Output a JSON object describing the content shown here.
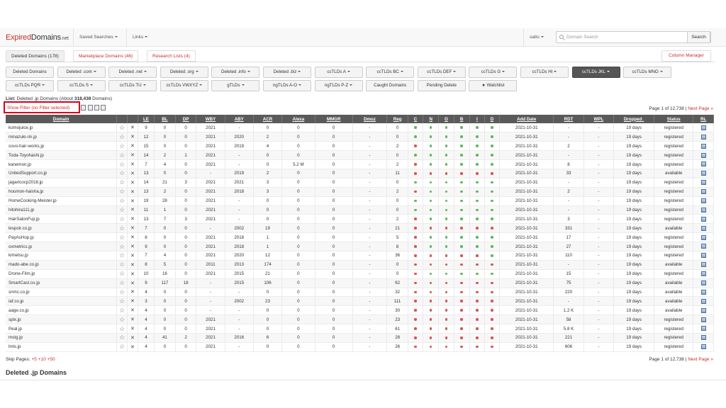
{
  "brand": {
    "part1": "Expired",
    "part2": "Domains",
    "part3": ".net"
  },
  "nav": {
    "saved_searches": "Saved Searches",
    "links": "Links",
    "user": "saito"
  },
  "search": {
    "placeholder": "Domain Search",
    "value": "",
    "button": "Search"
  },
  "tabs": [
    {
      "label": "Deleted Domains (178)",
      "active": true
    },
    {
      "label": "Marketplace Domains (46)",
      "active": false
    },
    {
      "label": "Research Lists (4)",
      "active": false
    }
  ],
  "column_manager": "Column Manager",
  "filters_row1": [
    {
      "label": "Deleted Domains",
      "caret": false,
      "active": false
    },
    {
      "label": "Deleted .com",
      "caret": true,
      "active": false
    },
    {
      "label": "Deleted .net",
      "caret": true,
      "active": false
    },
    {
      "label": "Deleted .org",
      "caret": true,
      "active": false
    },
    {
      "label": "Deleted .info",
      "caret": true,
      "active": false
    },
    {
      "label": "Deleted .biz",
      "caret": true,
      "active": false
    },
    {
      "label": "ccTLDs A",
      "caret": true,
      "active": false
    },
    {
      "label": "ccTLDs BC",
      "caret": true,
      "active": false
    },
    {
      "label": "ccTLDs DEF",
      "caret": true,
      "active": false
    },
    {
      "label": "ccTLDs G",
      "caret": true,
      "active": false
    },
    {
      "label": "ccTLDs HI",
      "caret": true,
      "active": false
    },
    {
      "label": "ccTLDs JKL",
      "caret": true,
      "active": true
    },
    {
      "label": "ccTLDs MNO",
      "caret": true,
      "active": false
    }
  ],
  "filters_row2": [
    {
      "label": "ccTLDs PQR",
      "caret": true
    },
    {
      "label": "ccTLDs S",
      "caret": true
    },
    {
      "label": "ccTLDs TU",
      "caret": true
    },
    {
      "label": "ccTLDs VWXYZ",
      "caret": true
    },
    {
      "label": "gTLDs",
      "caret": true
    },
    {
      "label": "ngTLDs A-O",
      "caret": true
    },
    {
      "label": "ngTLDs P-Z",
      "caret": true
    },
    {
      "label": "Caught Domains",
      "caret": false
    },
    {
      "label": "Pending Delete",
      "caret": false
    },
    {
      "label": "★ Watchlist",
      "caret": false
    }
  ],
  "list_info": {
    "prefix": "List:",
    "name": "Deleted .jp Domains (About",
    "count": "318,438",
    "suffix": "Domains)"
  },
  "show_filter": "Show Filter (no Filter selected)",
  "pager": {
    "text": "Page 1 of 12,738 |",
    "next": "Next Page »"
  },
  "columns": [
    "Domain",
    "",
    "",
    "LE",
    "BL",
    "DP",
    "WBY",
    "ABY",
    "ACR",
    "Alexa",
    "MMGR",
    "Dmoz",
    "Reg",
    "C",
    "N",
    "O",
    "B",
    "I",
    "D",
    "Add Date",
    "RDT",
    "WPL",
    "Dropped",
    "Status",
    "RL"
  ],
  "dropped_arrow": "↓",
  "rows": [
    {
      "domain": "komojuice.jp",
      "le": "9",
      "bl": "0",
      "dp": "0",
      "wby": "2021",
      "aby": "-",
      "acr": "0",
      "alexa": "0",
      "mmgr": "0",
      "dmoz": "-",
      "reg": "0",
      "dots": "gggggg",
      "date": "2021-10-31",
      "rdt": "-",
      "wpl": "-",
      "dropped": "19 days",
      "status": "registered"
    },
    {
      "domain": "minazuki-rin.jp",
      "le": "12",
      "bl": "0",
      "dp": "0",
      "wby": "2021",
      "aby": "2020",
      "acr": "2",
      "alexa": "0",
      "mmgr": "0",
      "dmoz": "-",
      "reg": "0",
      "dots": "gggggg",
      "date": "2021-10-31",
      "rdt": "-",
      "wpl": "-",
      "dropped": "19 days",
      "status": "registered"
    },
    {
      "domain": "covo-hair-works.jp",
      "le": "15",
      "bl": "0",
      "dp": "0",
      "wby": "2021",
      "aby": "2019",
      "acr": "4",
      "alexa": "0",
      "mmgr": "0",
      "dmoz": "-",
      "reg": "2",
      "dots": "rggggg",
      "date": "2021-10-31",
      "rdt": "2",
      "wpl": "-",
      "dropped": "19 days",
      "status": "registered"
    },
    {
      "domain": "Toda-Toyohashi.jp",
      "le": "14",
      "bl": "2",
      "dp": "1",
      "wby": "2021",
      "aby": "-",
      "acr": "0",
      "alexa": "0",
      "mmgr": "0",
      "dmoz": "-",
      "reg": "0",
      "dots": "gggggg",
      "date": "2021-10-31",
      "rdt": "-",
      "wpl": "-",
      "dropped": "19 days",
      "status": "registered"
    },
    {
      "domain": "kanemon.jp",
      "le": "7",
      "bl": "4",
      "dp": "0",
      "wby": "2021",
      "aby": "-",
      "acr": "0",
      "alexa": "5.2 M",
      "mmgr": "0",
      "dmoz": "-",
      "reg": "2",
      "dots": "rggggg",
      "date": "2021-10-31",
      "rdt": "8",
      "wpl": "-",
      "dropped": "19 days",
      "status": "registered"
    },
    {
      "domain": "UnitedSupport.co.jp",
      "le": "13",
      "bl": "0",
      "dp": "0",
      "wby": "-",
      "aby": "2019",
      "acr": "2",
      "alexa": "0",
      "mmgr": "0",
      "dmoz": "-",
      "reg": "11",
      "dots": "rrrrrr",
      "date": "2021-10-31",
      "rdt": "33",
      "wpl": "-",
      "dropped": "19 days",
      "status": "available"
    },
    {
      "domain": "jagaricocp2018.jp",
      "le": "14",
      "bl": "21",
      "dp": "3",
      "wby": "2021",
      "aby": "2021",
      "acr": "3",
      "alexa": "0",
      "mmgr": "0",
      "dmoz": "-",
      "reg": "0",
      "dots": "gggggg",
      "date": "2021-10-31",
      "rdt": "-",
      "wpl": "-",
      "dropped": "19 days",
      "status": "registered"
    },
    {
      "domain": "houmon-haisha.jp",
      "le": "13",
      "bl": "2",
      "dp": "0",
      "wby": "2021",
      "aby": "2018",
      "acr": "3",
      "alexa": "0",
      "mmgr": "0",
      "dmoz": "-",
      "reg": "2",
      "dots": "rggggg",
      "date": "2021-10-31",
      "rdt": "2",
      "wpl": "-",
      "dropped": "19 days",
      "status": "registered"
    },
    {
      "domain": "HomeCooking-Meister.jp",
      "le": "19",
      "bl": "28",
      "dp": "0",
      "wby": "2021",
      "aby": "-",
      "acr": "0",
      "alexa": "0",
      "mmgr": "0",
      "dmoz": "-",
      "reg": "0",
      "dots": "gggggg",
      "date": "2021-10-31",
      "rdt": "-",
      "wpl": "-",
      "dropped": "19 days",
      "status": "registered"
    },
    {
      "domain": "hitohira111.jp",
      "le": "11",
      "bl": "1",
      "dp": "0",
      "wby": "2021",
      "aby": "-",
      "acr": "0",
      "alexa": "0",
      "mmgr": "0",
      "dmoz": "-",
      "reg": "0",
      "dots": "gggggg",
      "date": "2021-10-31",
      "rdt": "-",
      "wpl": "-",
      "dropped": "19 days",
      "status": "registered"
    },
    {
      "domain": "HairSalonFuji.jp",
      "le": "13",
      "bl": "7",
      "dp": "3",
      "wby": "2021",
      "aby": "-",
      "acr": "0",
      "alexa": "0",
      "mmgr": "0",
      "dmoz": "-",
      "reg": "2",
      "dots": "rggggg",
      "date": "2021-10-31",
      "rdt": "3",
      "wpl": "-",
      "dropped": "19 days",
      "status": "registered"
    },
    {
      "domain": "lespoir.co.jp",
      "le": "7",
      "bl": "0",
      "dp": "0",
      "wby": "-",
      "aby": "2002",
      "acr": "19",
      "alexa": "0",
      "mmgr": "0",
      "dmoz": "-",
      "reg": "21",
      "dots": "rrrrrr",
      "date": "2021-10-31",
      "rdt": "331",
      "wpl": "-",
      "dropped": "19 days",
      "status": "available"
    },
    {
      "domain": "PayAsHop.jp",
      "le": "8",
      "bl": "0",
      "dp": "0",
      "wby": "2021",
      "aby": "2018",
      "acr": "1",
      "alexa": "0",
      "mmgr": "0",
      "dmoz": "-",
      "reg": "5",
      "dots": "rggggg",
      "date": "2021-10-31",
      "rdt": "17",
      "wpl": "-",
      "dropped": "19 days",
      "status": "registered"
    },
    {
      "domain": "oxmetrics.jp",
      "le": "9",
      "bl": "0",
      "dp": "0",
      "wby": "2021",
      "aby": "2018",
      "acr": "1",
      "alexa": "0",
      "mmgr": "0",
      "dmoz": "-",
      "reg": "8",
      "dots": "rggggg",
      "date": "2021-10-31",
      "rdt": "27",
      "wpl": "-",
      "dropped": "19 days",
      "status": "registered"
    },
    {
      "domain": "kimetsu.jp",
      "le": "7",
      "bl": "4",
      "dp": "0",
      "wby": "2021",
      "aby": "2020",
      "acr": "12",
      "alexa": "0",
      "mmgr": "0",
      "dmoz": "-",
      "reg": "36",
      "dots": "rrrrrg",
      "date": "2021-10-31",
      "rdt": "110",
      "wpl": "-",
      "dropped": "19 days",
      "status": "registered"
    },
    {
      "domain": "mado-abe.co.jp",
      "le": "8",
      "bl": "5",
      "dp": "0",
      "wby": "2011",
      "aby": "2013",
      "acr": "174",
      "alexa": "0",
      "mmgr": "0",
      "dmoz": "-",
      "reg": "0",
      "dots": "rrrrrr",
      "date": "2021-10-31",
      "rdt": "-",
      "wpl": "-",
      "dropped": "19 days",
      "status": "available"
    },
    {
      "domain": "Drone-Film.jp",
      "le": "10",
      "bl": "16",
      "dp": "0",
      "wby": "2021",
      "aby": "2015",
      "acr": "21",
      "alexa": "0",
      "mmgr": "0",
      "dmoz": "-",
      "reg": "0",
      "dots": "rggggg",
      "date": "2021-10-31",
      "rdt": "15",
      "wpl": "-",
      "dropped": "19 days",
      "status": "registered"
    },
    {
      "domain": "SmartCast.co.jp",
      "le": "9",
      "bl": "117",
      "dp": "18",
      "wby": "-",
      "aby": "2015",
      "acr": "106",
      "alexa": "0",
      "mmgr": "0",
      "dmoz": "-",
      "reg": "62",
      "dots": "rrrrrr",
      "date": "2021-10-31",
      "rdt": "75",
      "wpl": "-",
      "dropped": "19 days",
      "status": "available"
    },
    {
      "domain": "snmc.co.jp",
      "le": "4",
      "bl": "0",
      "dp": "0",
      "wby": "-",
      "aby": "-",
      "acr": "0",
      "alexa": "0",
      "mmgr": "0",
      "dmoz": "-",
      "reg": "32",
      "dots": "rrrrrr",
      "date": "2021-10-31",
      "rdt": "220",
      "wpl": "-",
      "dropped": "19 days",
      "status": "available"
    },
    {
      "domain": "iaf.co.jp",
      "le": "3",
      "bl": "0",
      "dp": "0",
      "wby": "-",
      "aby": "2002",
      "acr": "23",
      "alexa": "0",
      "mmgr": "0",
      "dmoz": "-",
      "reg": "111",
      "dots": "rrrrrr",
      "date": "2021-10-31",
      "rdt": "-",
      "wpl": "-",
      "dropped": "19 days",
      "status": "available"
    },
    {
      "domain": "aage.co.jp",
      "le": "4",
      "bl": "0",
      "dp": "0",
      "wby": "-",
      "aby": "-",
      "acr": "0",
      "alexa": "0",
      "mmgr": "0",
      "dmoz": "-",
      "reg": "30",
      "dots": "rrrrrr",
      "date": "2021-10-31",
      "rdt": "1.2 K",
      "wpl": "-",
      "dropped": "19 days",
      "status": "available"
    },
    {
      "domain": "splx.jp",
      "le": "4",
      "bl": "0",
      "dp": "0",
      "wby": "2021",
      "aby": "-",
      "acr": "0",
      "alexa": "0",
      "mmgr": "0",
      "dmoz": "-",
      "reg": "23",
      "dots": "rrrrrr",
      "date": "2021-10-31",
      "rdt": "58",
      "wpl": "-",
      "dropped": "19 days",
      "status": "registered"
    },
    {
      "domain": "Peal.jp",
      "le": "4",
      "bl": "0",
      "dp": "0",
      "wby": "2021",
      "aby": "-",
      "acr": "0",
      "alexa": "0",
      "mmgr": "0",
      "dmoz": "-",
      "reg": "61",
      "dots": "rrrrrr",
      "date": "2021-10-31",
      "rdt": "5.8 K",
      "wpl": "-",
      "dropped": "19 days",
      "status": "registered"
    },
    {
      "domain": "mstg.jp",
      "le": "4",
      "bl": "41",
      "dp": "2",
      "wby": "2021",
      "aby": "2016",
      "acr": "6",
      "alexa": "0",
      "mmgr": "0",
      "dmoz": "-",
      "reg": "28",
      "dots": "rrrrrr",
      "date": "2021-10-31",
      "rdt": "221",
      "wpl": "-",
      "dropped": "19 days",
      "status": "registered"
    },
    {
      "domain": "lmls.jp",
      "le": "4",
      "bl": "0",
      "dp": "0",
      "wby": "2021",
      "aby": "-",
      "acr": "0",
      "alexa": "0",
      "mmgr": "0",
      "dmoz": "-",
      "reg": "26",
      "dots": "rrrrrr",
      "date": "2021-10-31",
      "rdt": "606",
      "wpl": "-",
      "dropped": "19 days",
      "status": "registered"
    }
  ],
  "skip_pages": {
    "label": "Skip Pages:",
    "links": [
      "+5",
      "+10",
      "+50"
    ]
  },
  "section_title": "Deleted .jp Domains",
  "colors": {
    "accent": "#c9302c",
    "header_bg": "#5a5a5a",
    "active_btn": "#555555",
    "dot_green": "#5cb85c",
    "dot_red": "#d9534f",
    "available": "#2e8b1e",
    "highlight_box": "#d9001b"
  }
}
